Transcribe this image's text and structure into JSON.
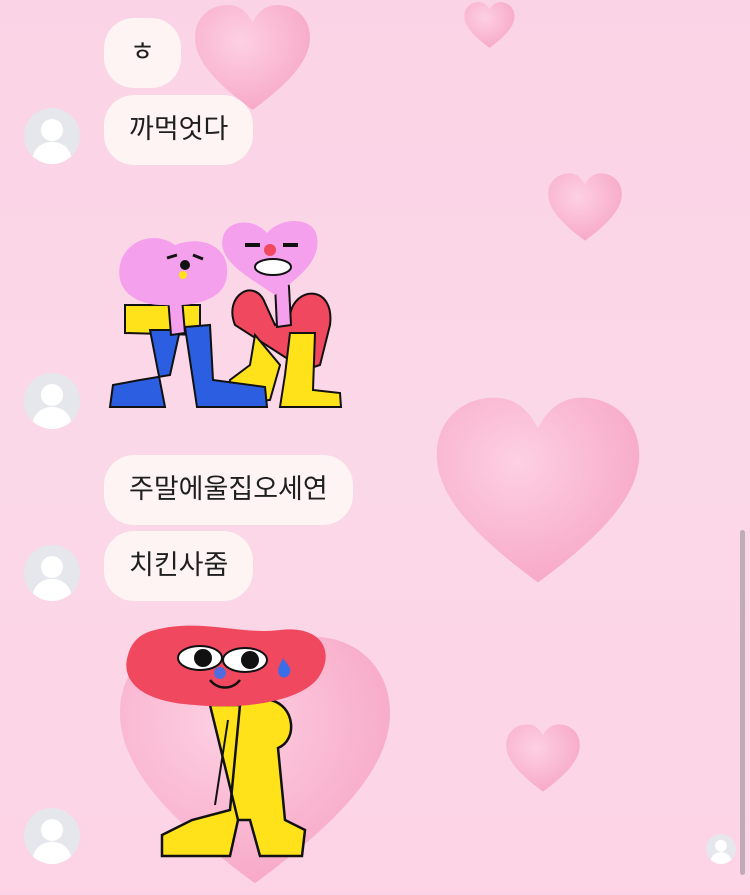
{
  "chat": {
    "messages": [
      {
        "type": "text",
        "text": "ㅎ"
      },
      {
        "type": "text",
        "text": "까먹엇다"
      },
      {
        "type": "sticker",
        "sticker": "two-heart-characters-sticker"
      },
      {
        "type": "text",
        "text": "주말에울집오세연"
      },
      {
        "type": "text",
        "text": "치킨사줌"
      },
      {
        "type": "sticker",
        "sticker": "red-head-character-sweat-sticker"
      }
    ]
  },
  "colors": {
    "background": "#fbd6e7",
    "bubble": "#fdf4f3",
    "avatar": "#e6e7ec",
    "heart": "#f9a9c8"
  }
}
